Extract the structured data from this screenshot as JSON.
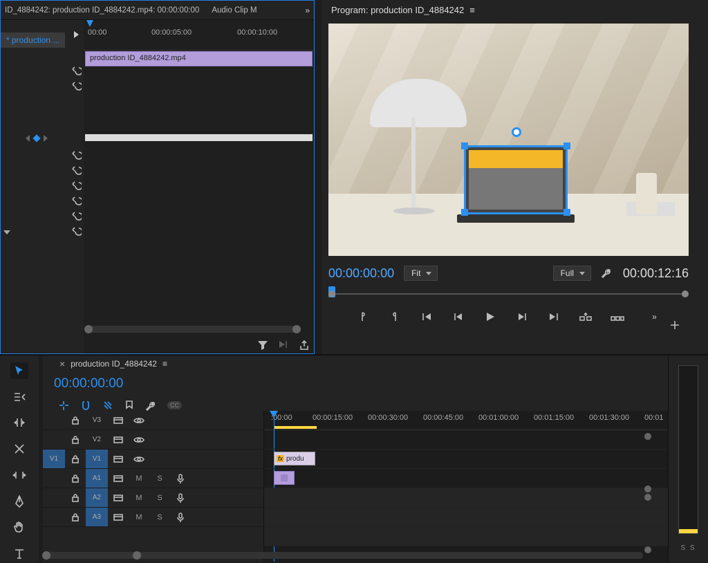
{
  "source_panel": {
    "tab_info": "ID_4884242: production ID_4884242.mp4: 00:00:00:00",
    "tab_right": "Audio Clip M",
    "track_tab": "* production ...",
    "ruler": [
      "00:00",
      "00:00:05:00",
      "00:00:10:00"
    ],
    "clip_name": "production ID_4884242.mp4"
  },
  "program_panel": {
    "title": "Program: production ID_4884242",
    "tc_in": "00:00:00:00",
    "fit_label": "Fit",
    "full_label": "Full",
    "tc_out": "00:00:12:16"
  },
  "timeline": {
    "seq_name": "production ID_4884242",
    "tc": "00:00:00:00",
    "ruler": [
      ":00:00",
      "00:00:15:00",
      "00:00:30:00",
      "00:00:45:00",
      "00:01:00:00",
      "00:01:15:00",
      "00:01:30:00",
      "00:01"
    ],
    "tracks": {
      "v": [
        "V3",
        "V2",
        "V1"
      ],
      "a": [
        "A1",
        "A2",
        "A3"
      ],
      "src_v": "V1"
    },
    "clip_v2_fx": "fx",
    "clip_v2_label": "produ",
    "toggles": {
      "mute": "M",
      "solo": "S"
    }
  },
  "meters": {
    "label": "S  S"
  }
}
